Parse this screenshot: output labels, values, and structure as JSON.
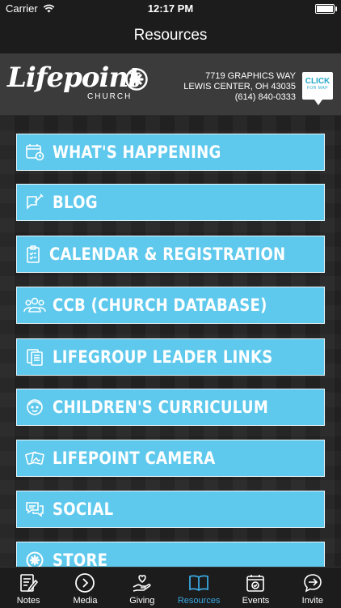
{
  "status_bar": {
    "carrier": "Carrier",
    "time": "12:17 PM"
  },
  "nav": {
    "title": "Resources"
  },
  "header": {
    "logo_text": "Lifepoint",
    "logo_subtext": "CHURCH",
    "address_line1": "7719 GRAPHICS WAY",
    "address_line2": "LEWIS CENTER, OH 43035",
    "phone": "(614) 840-0333",
    "map_button_label": "CLICK",
    "map_button_sub": "FOR MAP"
  },
  "menu_items": [
    {
      "label": "WHAT'S HAPPENING",
      "icon": "calendar-clock-icon"
    },
    {
      "label": "BLOG",
      "icon": "edit-note-icon"
    },
    {
      "label": "CALENDAR & REGISTRATION",
      "icon": "clipboard-check-icon"
    },
    {
      "label": "CCB (CHURCH DATABASE)",
      "icon": "people-group-icon"
    },
    {
      "label": "LIFEGROUP LEADER LINKS",
      "icon": "documents-icon"
    },
    {
      "label": "CHILDREN'S CURRICULUM",
      "icon": "child-face-icon"
    },
    {
      "label": "LIFEPOINT CAMERA",
      "icon": "photos-icon"
    },
    {
      "label": "SOCIAL",
      "icon": "chat-bubbles-icon"
    },
    {
      "label": "STORE",
      "icon": "lifepoint-star-icon"
    }
  ],
  "tabs": [
    {
      "label": "Notes",
      "icon": "notes-icon",
      "active": false
    },
    {
      "label": "Media",
      "icon": "play-circle-icon",
      "active": false
    },
    {
      "label": "Giving",
      "icon": "giving-hand-icon",
      "active": false
    },
    {
      "label": "Resources",
      "icon": "open-book-icon",
      "active": true
    },
    {
      "label": "Events",
      "icon": "calendar-check-icon",
      "active": false
    },
    {
      "label": "Invite",
      "icon": "chat-arrow-icon",
      "active": false
    }
  ],
  "colors": {
    "accent": "#5ec9ed",
    "tab_active": "#3aa7e0",
    "bar_bg": "#1c1c1c"
  }
}
